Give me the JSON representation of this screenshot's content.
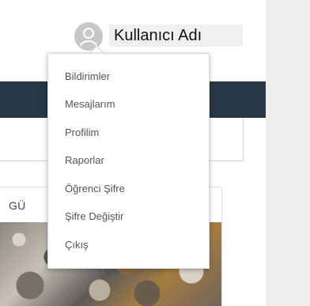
{
  "header": {
    "user_name": "Kullanıcı Adı"
  },
  "user_menu": {
    "items": [
      {
        "label": "Bildirimler"
      },
      {
        "label": "Mesajlarım"
      },
      {
        "label": "Profilim"
      },
      {
        "label": "Raporlar"
      },
      {
        "label": "Öğrenci Şifre"
      },
      {
        "label": "Şifre Değiştir"
      },
      {
        "label": "Çıkış"
      }
    ]
  },
  "content": {
    "card_tab_label": "GÜ"
  },
  "icons": {
    "avatar": "user-avatar-icon"
  },
  "colors": {
    "navbar": "#263746",
    "background_right": "#ededed",
    "avatar": "#c7c7c7",
    "username_highlight": "#f0f0f0",
    "menu_text": "#555555"
  }
}
